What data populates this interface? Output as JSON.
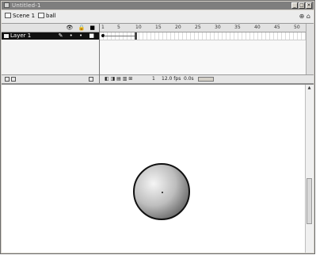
{
  "window": {
    "title": "Untitled-1",
    "controls": [
      "_",
      "□",
      "×"
    ]
  },
  "editbar": {
    "scene_label": "Scene 1",
    "symbol_label": "ball",
    "tools": "⊕ ⌂"
  },
  "timeline": {
    "header_icons": "👁 🔒 ■",
    "layers": [
      {
        "name": "Layer 1",
        "controls": "✎ • • ■"
      }
    ],
    "ruler_ticks": [
      "1",
      "5",
      "10",
      "15",
      "20",
      "25",
      "30",
      "35",
      "40",
      "45",
      "50"
    ],
    "footer": {
      "frame": "1",
      "fps": "12.0 fps",
      "time": "0.0s"
    }
  },
  "stage": {
    "scroll_up": "▲"
  }
}
